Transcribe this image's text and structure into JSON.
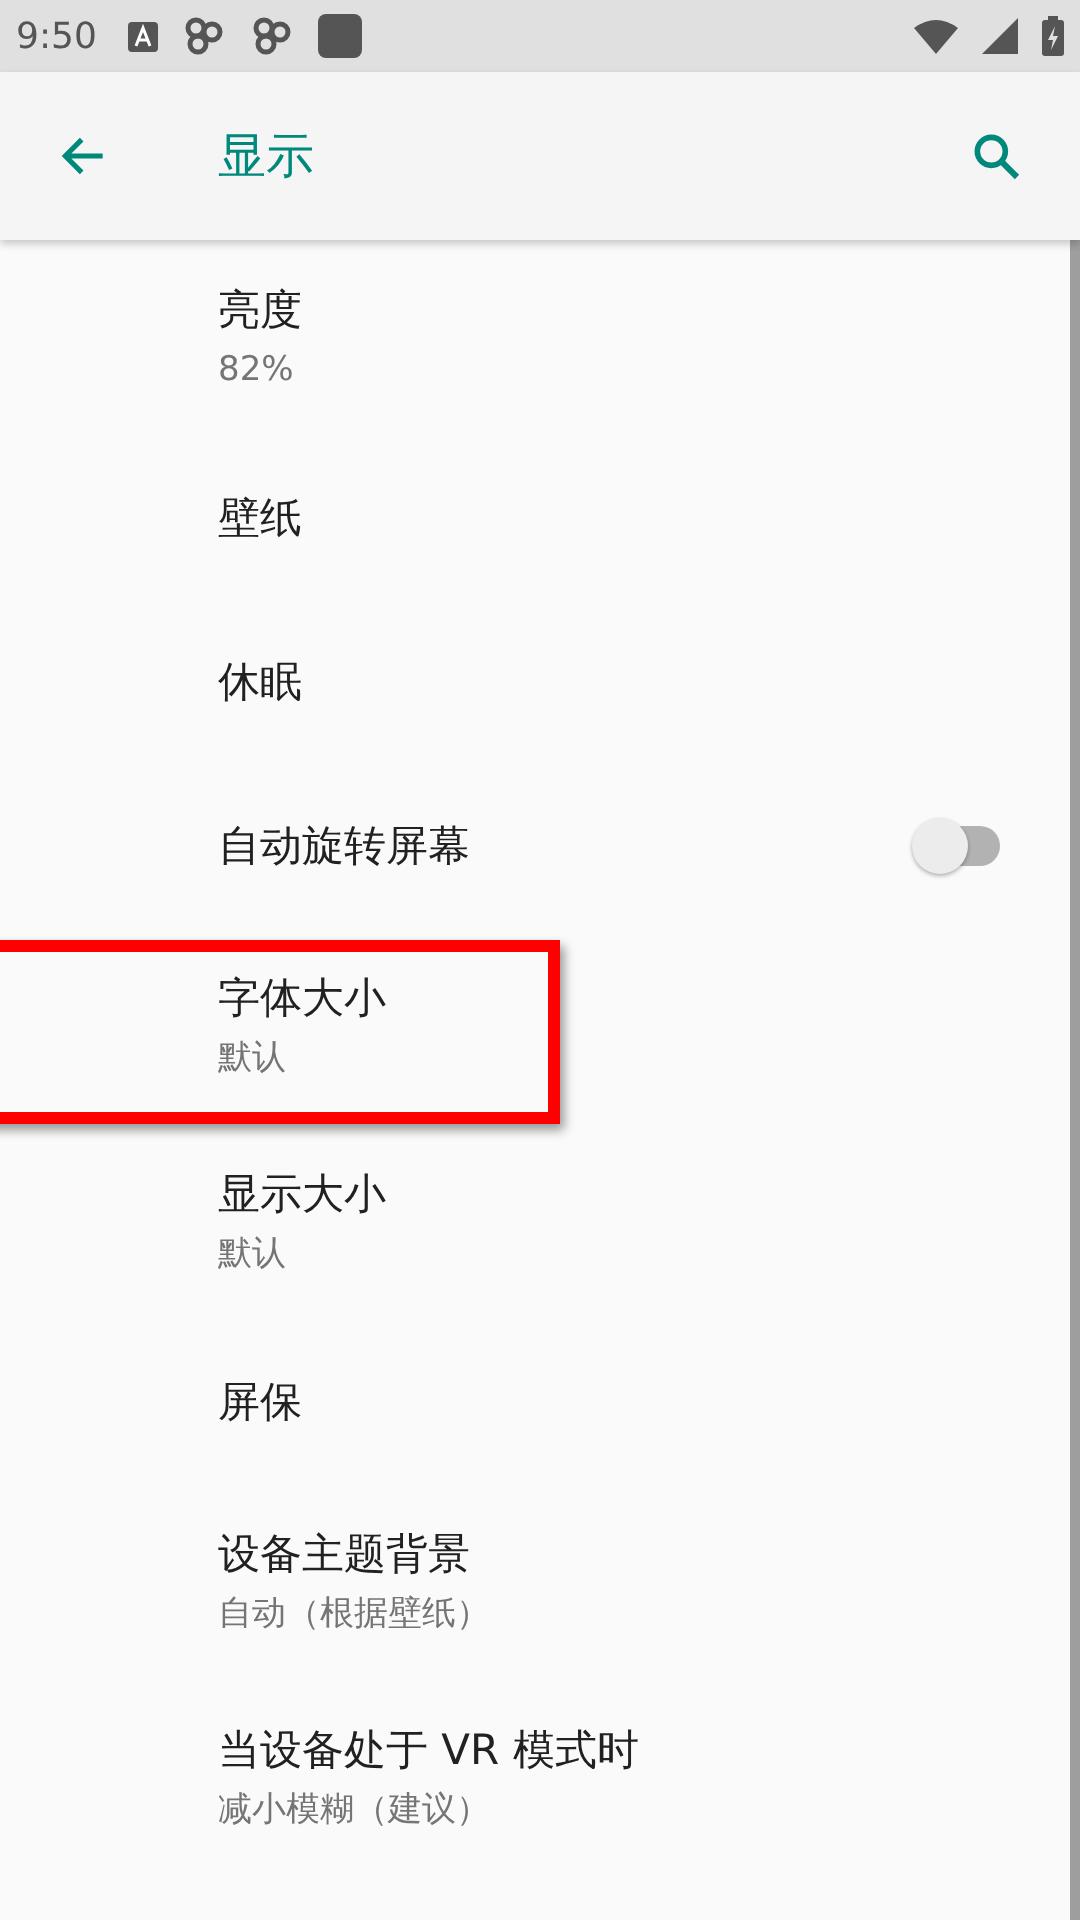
{
  "status_bar": {
    "time": "9:50"
  },
  "toolbar": {
    "title": "显示"
  },
  "items": [
    {
      "kind": "text",
      "title": "亮度",
      "summary": "82%",
      "highlighted": false
    },
    {
      "kind": "text",
      "title": "壁纸",
      "highlighted": false
    },
    {
      "kind": "text",
      "title": "休眠",
      "highlighted": false
    },
    {
      "kind": "switch",
      "title": "自动旋转屏幕",
      "on": false,
      "highlighted": false
    },
    {
      "kind": "text",
      "title": "字体大小",
      "summary": "默认",
      "highlighted": true
    },
    {
      "kind": "text",
      "title": "显示大小",
      "summary": "默认",
      "highlighted": false
    },
    {
      "kind": "text",
      "title": "屏保",
      "highlighted": false
    },
    {
      "kind": "text",
      "title": "设备主题背景",
      "summary": "自动（根据壁纸）",
      "highlighted": false
    },
    {
      "kind": "text",
      "title": "当设备处于 VR 模式时",
      "summary": "减小模糊（建议）",
      "highlighted": false
    }
  ]
}
